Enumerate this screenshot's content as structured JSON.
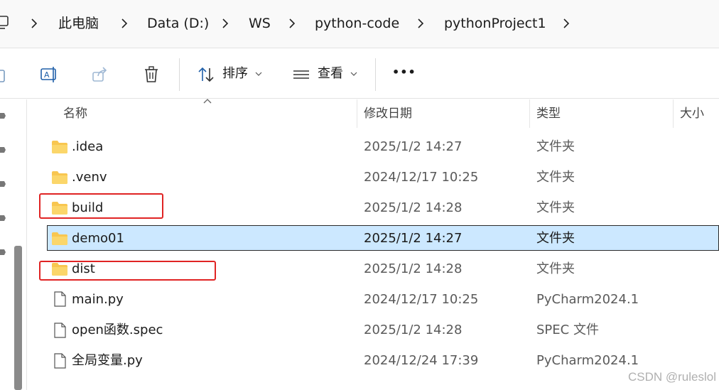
{
  "breadcrumb": {
    "items": [
      "此电脑",
      "Data (D:)",
      "WS",
      "python-code",
      "pythonProject1"
    ]
  },
  "toolbar": {
    "sort_label": "排序",
    "view_label": "查看",
    "more_label": "•••"
  },
  "columns": {
    "name": "名称",
    "date": "修改日期",
    "type": "类型",
    "size": "大小"
  },
  "files": [
    {
      "name": ".idea",
      "date": "2025/1/2 14:27",
      "type": "文件夹",
      "kind": "folder"
    },
    {
      "name": ".venv",
      "date": "2024/12/17 10:25",
      "type": "文件夹",
      "kind": "folder"
    },
    {
      "name": "build",
      "date": "2025/1/2 14:28",
      "type": "文件夹",
      "kind": "folder",
      "highlighted": true
    },
    {
      "name": "demo01",
      "date": "2025/1/2 14:27",
      "type": "文件夹",
      "kind": "folder",
      "selected": true
    },
    {
      "name": "dist",
      "date": "2025/1/2 14:28",
      "type": "文件夹",
      "kind": "folder",
      "highlighted": true
    },
    {
      "name": "main.py",
      "date": "2024/12/17 10:25",
      "type": "PyCharm2024.1",
      "kind": "file"
    },
    {
      "name": "open函数.spec",
      "date": "2025/1/2 14:28",
      "type": "SPEC 文件",
      "kind": "file"
    },
    {
      "name": "全局变量.py",
      "date": "2024/12/24 17:39",
      "type": "PyCharm2024.1",
      "kind": "file"
    }
  ],
  "watermark": "CSDN @ruleslol",
  "colors": {
    "selection": "#cce8ff",
    "highlight_box": "#e02424",
    "folder": "#f8c650"
  }
}
